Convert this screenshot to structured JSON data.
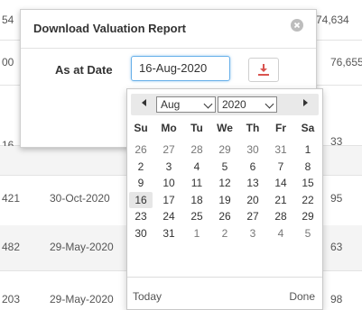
{
  "background_table": {
    "rows": [
      {
        "id": "54",
        "date": "",
        "amount": "74,634"
      },
      {
        "id": "00",
        "date": "",
        "amount": "76,655"
      },
      {
        "id": "16",
        "date": "",
        "amount": "33"
      },
      {
        "id": "",
        "date": "",
        "amount": ""
      },
      {
        "id": "421",
        "date": "30-Oct-2020",
        "amount": "95"
      },
      {
        "id": "482",
        "date": "29-May-2020",
        "amount": "63"
      },
      {
        "id": "203",
        "date": "29-May-2020",
        "amount": "98"
      }
    ]
  },
  "dialog": {
    "title": "Download Valuation Report",
    "as_at_label": "As at Date",
    "date_value": "16-Aug-2020"
  },
  "datepicker": {
    "month": "Aug",
    "year": "2020",
    "weekdays": [
      "Su",
      "Mo",
      "Tu",
      "We",
      "Th",
      "Fr",
      "Sa"
    ],
    "weeks": [
      [
        "26",
        "27",
        "28",
        "29",
        "30",
        "31",
        "1"
      ],
      [
        "2",
        "3",
        "4",
        "5",
        "6",
        "7",
        "8"
      ],
      [
        "9",
        "10",
        "11",
        "12",
        "13",
        "14",
        "15"
      ],
      [
        "16",
        "17",
        "18",
        "19",
        "20",
        "21",
        "22"
      ],
      [
        "23",
        "24",
        "25",
        "26",
        "27",
        "28",
        "29"
      ],
      [
        "30",
        "31",
        "1",
        "2",
        "3",
        "4",
        "5"
      ]
    ],
    "selected_day": "16",
    "today_label": "Today",
    "done_label": "Done"
  },
  "colors": {
    "download_icon": "#d9534f",
    "focus_border": "#66afe9"
  }
}
